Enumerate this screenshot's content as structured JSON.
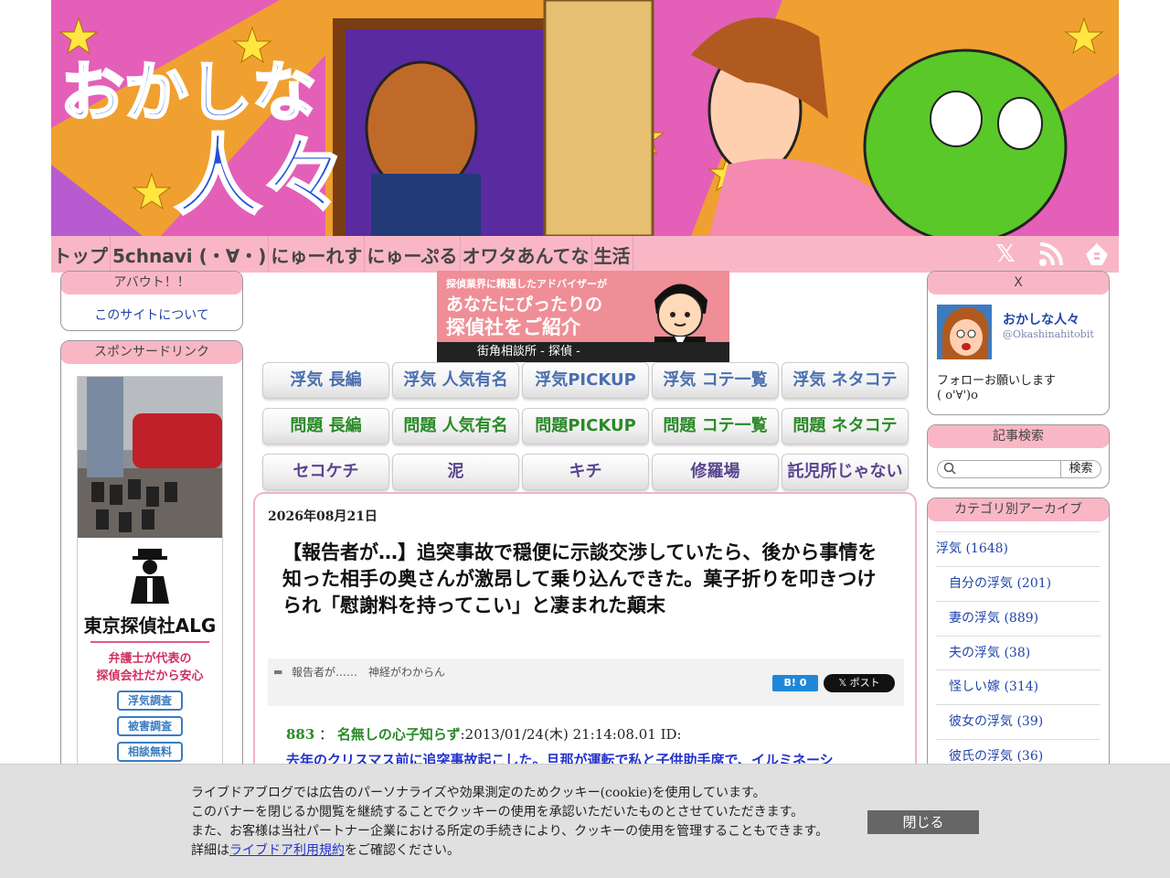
{
  "site": {
    "title_line1": "おかしな",
    "title_line2": "人々"
  },
  "nav": [
    "トップ",
    "5chnavi (・∀・)",
    "にゅーれす",
    "にゅーぷる",
    "オワタあんてな",
    "生活"
  ],
  "nav_icons": [
    "x-icon",
    "rss-icon",
    "feedly-icon"
  ],
  "about": {
    "heading": "アバウト！！",
    "link": "このサイトについて"
  },
  "sponsor": {
    "heading": "スポンサードリンク",
    "company": "東京探偵社ALG",
    "line1": "弁護士が代表の",
    "line2": "探偵会社だから安心",
    "btn1": "浮気調査",
    "btn2": "被害調査",
    "btn3": "相談無料"
  },
  "ad_banner": {
    "line1": "探偵業界に精通したアドバイザーが",
    "line2": "あなたにぴったりの",
    "line3": "探偵社をご紹介",
    "caption": "街角相談所 - 探偵 -"
  },
  "buttons": [
    [
      "浮気 長編",
      "浮気 人気有名",
      "浮気PICKUP",
      "浮気 コテ一覧",
      "浮気 ネタコテ"
    ],
    [
      "問題 長編",
      "問題 人気有名",
      "問題PICKUP",
      "問題 コテ一覧",
      "問題 ネタコテ"
    ],
    [
      "セコケチ",
      "泥",
      "キチ",
      "修羅場",
      "託児所じゃない"
    ]
  ],
  "article": {
    "date": "2026年08月21日",
    "title": "【報告者が…】追突事故で穏便に示談交渉していたら、後から事情を知った相手の奥さんが激昂して乗り込んできた。菓子折りを叩きつけられ「慰謝料を持ってこい」と凄まれた顛末",
    "tags": "報告者が……　神経がわからん",
    "hatena": "B! 0",
    "post": "ポスト",
    "post_num": "883",
    "post_sep": "：",
    "poster": "名無しの心子知らず",
    "post_meta": ":2013/01/24(木) 21:14:08.01 ID:",
    "body": "去年のクリスマス前に追突事故起こした。旦那が運転で私と子供助手席で、イルミネーシ"
  },
  "twitter": {
    "heading": "X",
    "name": "おかしな人々",
    "handle": "@Okashinahitobit",
    "follow": "フォローお願いします",
    "face": "( o'∀')o"
  },
  "search": {
    "heading": "記事検索",
    "button": "検索",
    "placeholder": ""
  },
  "archive": {
    "heading": "カテゴリ別アーカイブ",
    "items": [
      "浮気 (1648)",
      "自分の浮気 (201)",
      "妻の浮気 (889)",
      "夫の浮気 (38)",
      "怪しい嫁 (314)",
      "彼女の浮気 (39)",
      "彼氏の浮気 (36)"
    ]
  },
  "cookie": {
    "line1": "ライブドアブログでは広告のパーソナライズや効果測定のためクッキー(cookie)を使用しています。",
    "line2": "このバナーを閉じるか閲覧を継続することでクッキーの使用を承認いただいたものとさせていただきます。",
    "line3": "また、お客様は当社パートナー企業における所定の手続きにより、クッキーの使用を管理することもできます。",
    "line4_pre": "詳細は",
    "line4_link": "ライブドア利用規約",
    "line4_post": "をご確認ください。",
    "close": "閉じる"
  }
}
